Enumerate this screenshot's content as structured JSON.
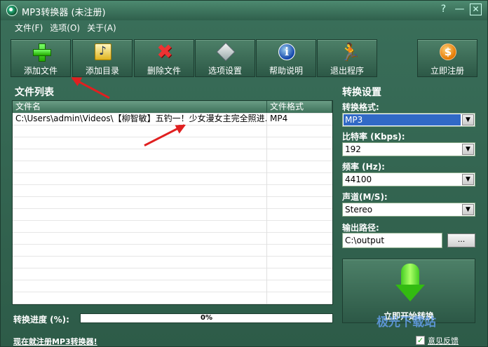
{
  "window": {
    "title": "MP3转换器 (未注册)",
    "controls": {
      "help": "?",
      "minimize": "—",
      "close": "☒"
    }
  },
  "menu": [
    "文件(F)",
    "选项(O)",
    "关于(A)"
  ],
  "toolbar": {
    "add_file": "添加文件",
    "add_folder": "添加目录",
    "delete_file": "删除文件",
    "options": "选项设置",
    "help": "帮助说明",
    "exit": "退出程序",
    "register": "立即注册"
  },
  "file_list": {
    "label": "文件列表",
    "columns": [
      "文件名",
      "文件格式"
    ],
    "rows": [
      {
        "name": "C:\\Users\\admin\\Videos\\【柳智敏】五钓一！少女漫女主完全照进...",
        "format": "MP4"
      }
    ]
  },
  "progress": {
    "label": "转换进度 (%):",
    "value": 0,
    "text": "0%"
  },
  "settings": {
    "label": "转换设置",
    "format": {
      "label": "转换格式:",
      "value": "MP3"
    },
    "bitrate": {
      "label": "比特率 (Kbps):",
      "value": "192"
    },
    "frequency": {
      "label": "频率 (Hz):",
      "value": "44100"
    },
    "channel": {
      "label": "声道(M/S):",
      "value": "Stereo"
    },
    "output": {
      "label": "输出路径:",
      "value": "C:\\output",
      "browse": "..."
    }
  },
  "start_button": "立即开始转换",
  "status": {
    "register_link": "现在就注册MP3转换器!",
    "feedback": "意见反馈"
  },
  "watermark": "极光下载站",
  "colors": {
    "accent": "#2f5f4c",
    "selection": "#3169c6",
    "annotation": "#e02020"
  }
}
